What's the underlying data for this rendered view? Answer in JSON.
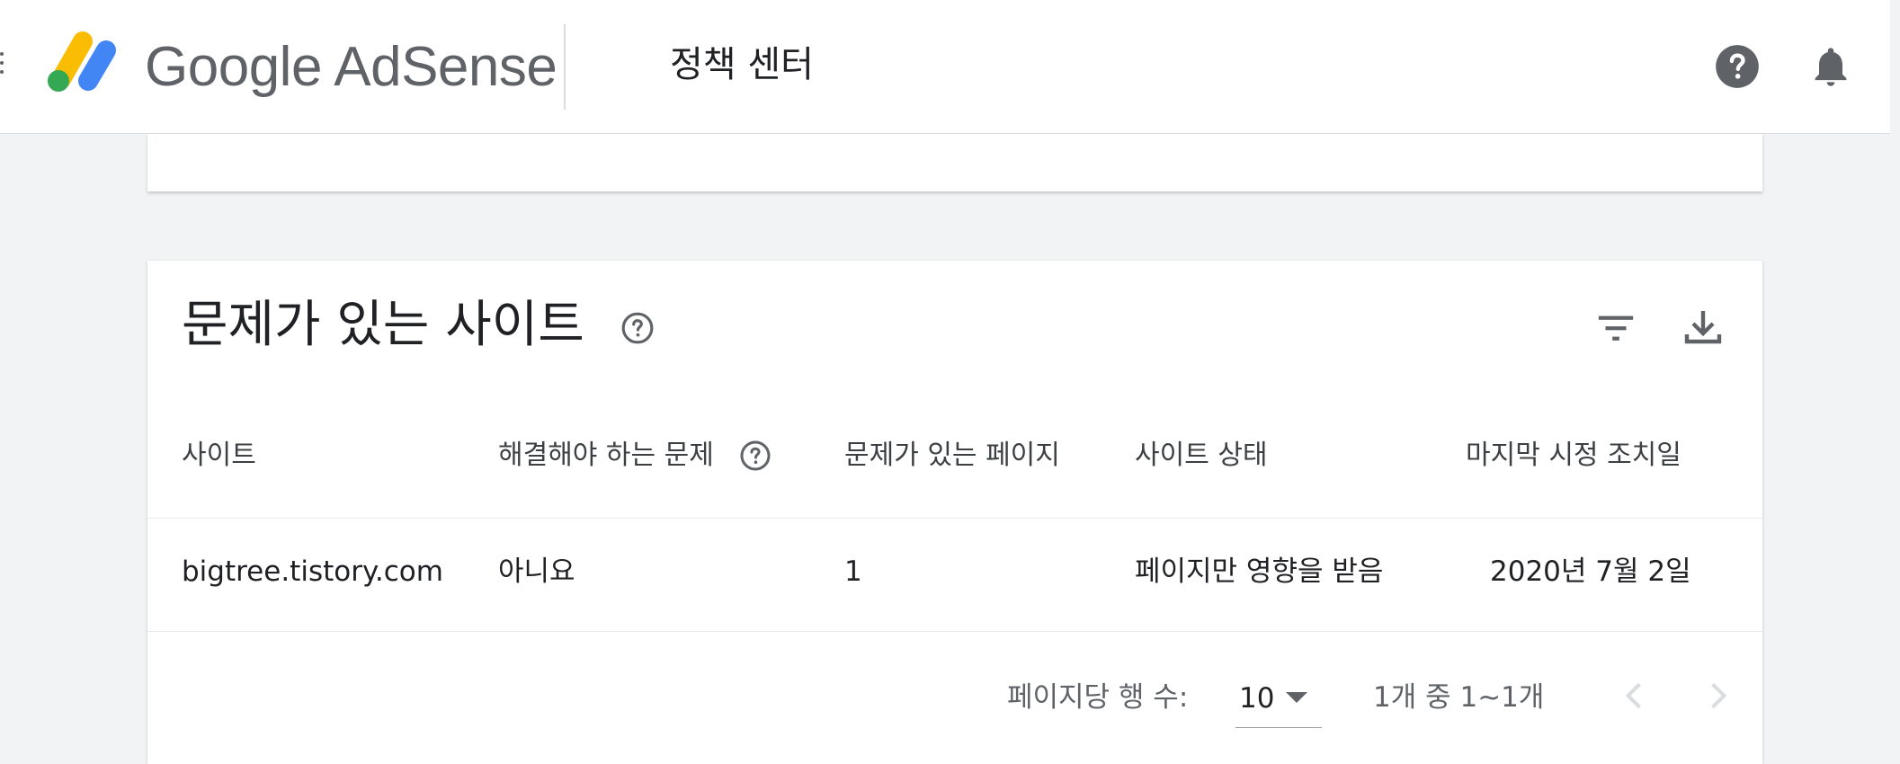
{
  "header": {
    "menu_icon": "more-vert-icon",
    "brand_logo": "google-adsense-logo",
    "brand_name": "Google AdSense",
    "page_title": "정책 센터",
    "help_icon": "help-icon",
    "notifications_icon": "bell-icon"
  },
  "sites_card": {
    "title": "문제가 있는 사이트",
    "title_help_icon": "help-outline-icon",
    "filter_icon": "filter-list-icon",
    "download_icon": "download-icon",
    "table": {
      "columns": [
        "사이트",
        "해결해야 하는 문제",
        "문제가 있는 페이지",
        "사이트 상태",
        "마지막 시정 조치일"
      ],
      "rows": [
        {
          "site": "bigtree.tistory.com",
          "must_fix": "아니요",
          "pages_with_issues": "1",
          "site_status": "페이지만 영향을 받음",
          "last_action_date": "2020년 7월 2일"
        }
      ]
    },
    "pagination": {
      "rows_per_page_label": "페이지당 행 수:",
      "rows_per_page_value": "10",
      "range_text": "1개 중 1~1개",
      "prev_icon": "chevron-left-icon",
      "next_icon": "chevron-right-icon"
    }
  },
  "colors": {
    "logo_yellow": "#fbbc04",
    "logo_blue": "#4285f4",
    "logo_green": "#34a853",
    "icon_gray": "#5f6368",
    "disabled_gray": "#dadce0"
  }
}
